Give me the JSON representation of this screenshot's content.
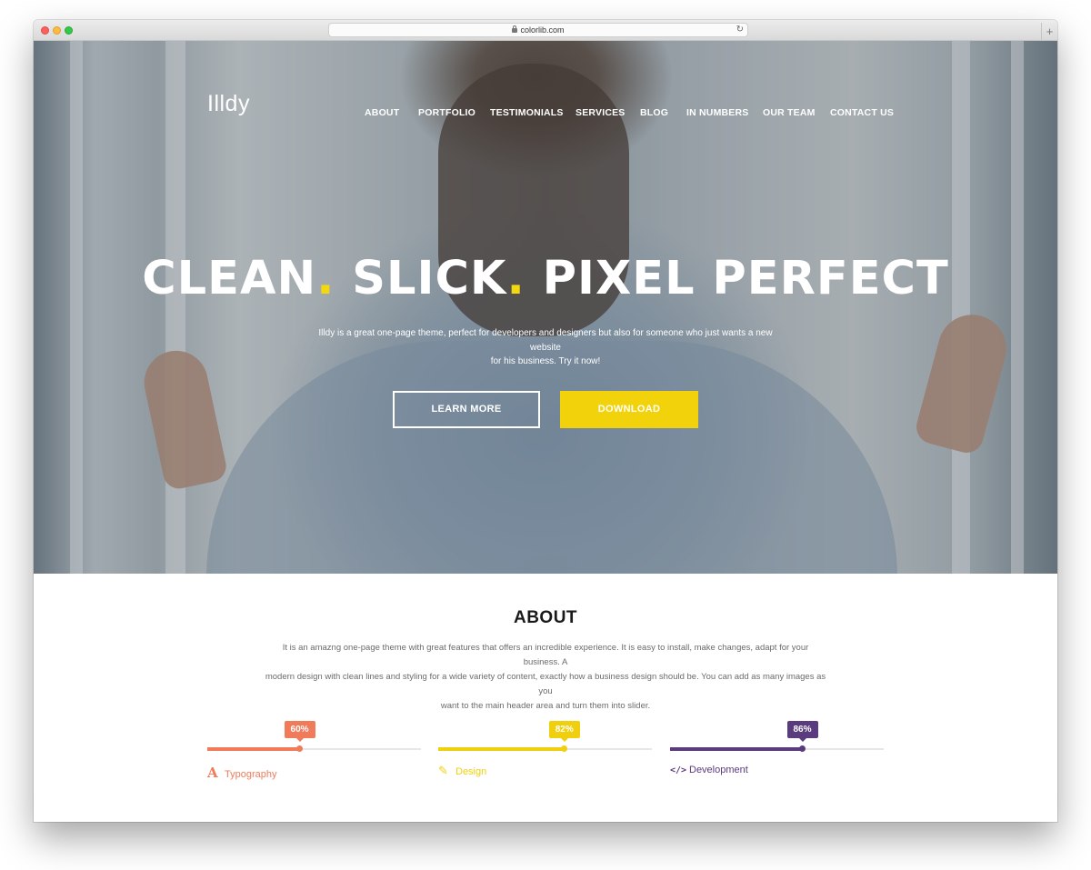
{
  "browser": {
    "url": "colorlib.com"
  },
  "hero": {
    "logo": "Illdy",
    "nav": [
      "ABOUT",
      "PORTFOLIO",
      "TESTIMONIALS",
      "SERVICES",
      "BLOG",
      "IN NUMBERS",
      "OUR TEAM",
      "CONTACT US"
    ],
    "headline_parts": [
      "CLEAN",
      ".",
      " SLICK",
      ".",
      " PIXEL PERFECT"
    ],
    "subtext_line1": "Illdy is a great one-page theme, perfect for developers and designers but also for someone who just wants a new website",
    "subtext_line2": "for his business. Try it now!",
    "learn_more_label": "LEARN MORE",
    "download_label": "DOWNLOAD",
    "accent_color": "#f1d20b"
  },
  "about": {
    "title": "ABOUT",
    "text_line1": "It is an amazng one-page theme with great features that offers an incredible experience. It is easy to install, make changes, adapt for your business. A",
    "text_line2": "modern design with clean lines and styling for a wide variety of content, exactly how a business design should be. You can add as many images as you",
    "text_line3": "want to the main header area and turn them into slider.",
    "skills": [
      {
        "name": "Typography",
        "percent": 60,
        "label": "60%",
        "color": "#f07b5a",
        "icon": "typography-icon",
        "glyph": "A"
      },
      {
        "name": "Design",
        "percent": 82,
        "label": "82%",
        "color": "#f0d00e",
        "icon": "pencil-icon",
        "glyph": "✎"
      },
      {
        "name": "Development",
        "percent": 86,
        "label": "86%",
        "color": "#5a3c7e",
        "icon": "code-icon",
        "glyph": "</>"
      }
    ]
  }
}
